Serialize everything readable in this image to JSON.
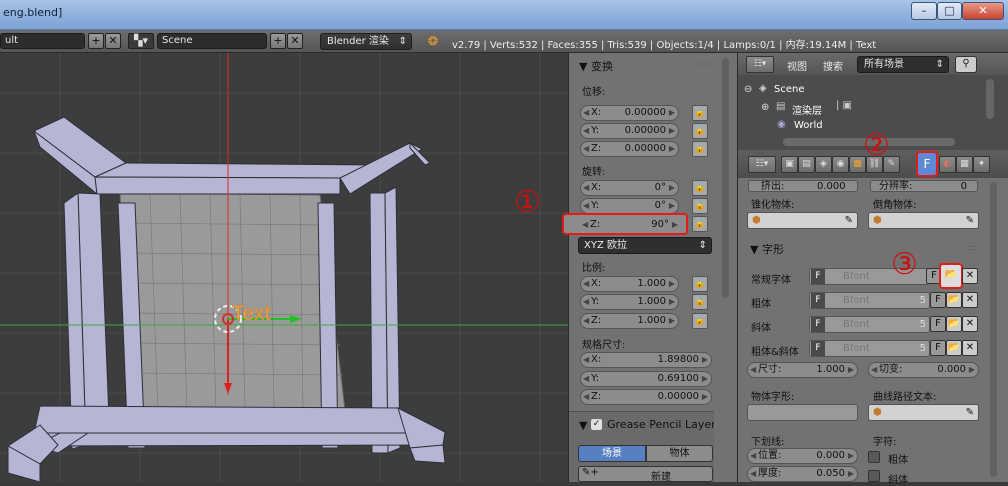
{
  "window": {
    "title": "eng.blend]",
    "min": "–",
    "max": "□",
    "close": "✕"
  },
  "header": {
    "layout_field": "ult",
    "scene_field": "Scene",
    "render_engine": "Blender 渲染",
    "stats": "v2.79 | Verts:532 | Faces:355 | Tris:539 | Objects:1/4 | Lamps:0/1 | 内存:19.14M | Text"
  },
  "viewport": {
    "text_object": "Text"
  },
  "transform": {
    "title": "▼ 变换",
    "location_label": "位移:",
    "location": [
      {
        "axis": "X:",
        "value": "0.00000"
      },
      {
        "axis": "Y:",
        "value": "0.00000"
      },
      {
        "axis": "Z:",
        "value": "0.00000"
      }
    ],
    "rotation_label": "旋转:",
    "rotation": [
      {
        "axis": "X:",
        "value": "0°"
      },
      {
        "axis": "Y:",
        "value": "0°"
      },
      {
        "axis": "Z:",
        "value": "90°"
      }
    ],
    "rotation_mode": "XYZ 欧拉",
    "scale_label": "比例:",
    "scale": [
      {
        "axis": "X:",
        "value": "1.000"
      },
      {
        "axis": "Y:",
        "value": "1.000"
      },
      {
        "axis": "Z:",
        "value": "1.000"
      }
    ],
    "dimensions_label": "规格尺寸:",
    "dimensions": [
      {
        "axis": "X:",
        "value": "1.89800"
      },
      {
        "axis": "Y:",
        "value": "0.69100"
      },
      {
        "axis": "Z:",
        "value": "0.00000"
      }
    ],
    "grease_title": "Grease Pencil Layers",
    "tab_scene": "场景",
    "tab_object": "物体",
    "new_label": "新建"
  },
  "outliner": {
    "view": "视图",
    "search": "搜索",
    "filter": "所有场景",
    "scene": "Scene",
    "render_layer": "渲染层",
    "world": "World"
  },
  "props": {
    "extrude_label": "挤出:",
    "extrude_value": "0.000",
    "resolution_label": "分辨率:",
    "resolution_value": "0",
    "taper_label": "锥化物体:",
    "bevel_label": "倒角物体:",
    "font_section": "▼ 字形",
    "fonts": [
      {
        "label": "常规字体",
        "name": "Bfont",
        "num": ""
      },
      {
        "label": "粗体",
        "name": "Bfont",
        "num": "5"
      },
      {
        "label": "斜体",
        "name": "Bfont",
        "num": "5"
      },
      {
        "label": "粗体&斜体",
        "name": "Bfont",
        "num": "5"
      }
    ],
    "size_label": "尺寸:",
    "size_value": "1.000",
    "shear_label": "切变:",
    "shear_value": "0.000",
    "object_font_label": "物体字形:",
    "text_on_curve_label": "曲线路径文本:",
    "underline_label": "下划线:",
    "position_label": "位置:",
    "position_value": "0.000",
    "thickness_label": "厚度:",
    "thickness_value": "0.050",
    "char_label": "字符:",
    "bold_label": "粗体",
    "italic_label": "斜体",
    "tab_font_glyph": "F"
  },
  "annotations": {
    "one": "①",
    "two": "②",
    "three": "③"
  }
}
